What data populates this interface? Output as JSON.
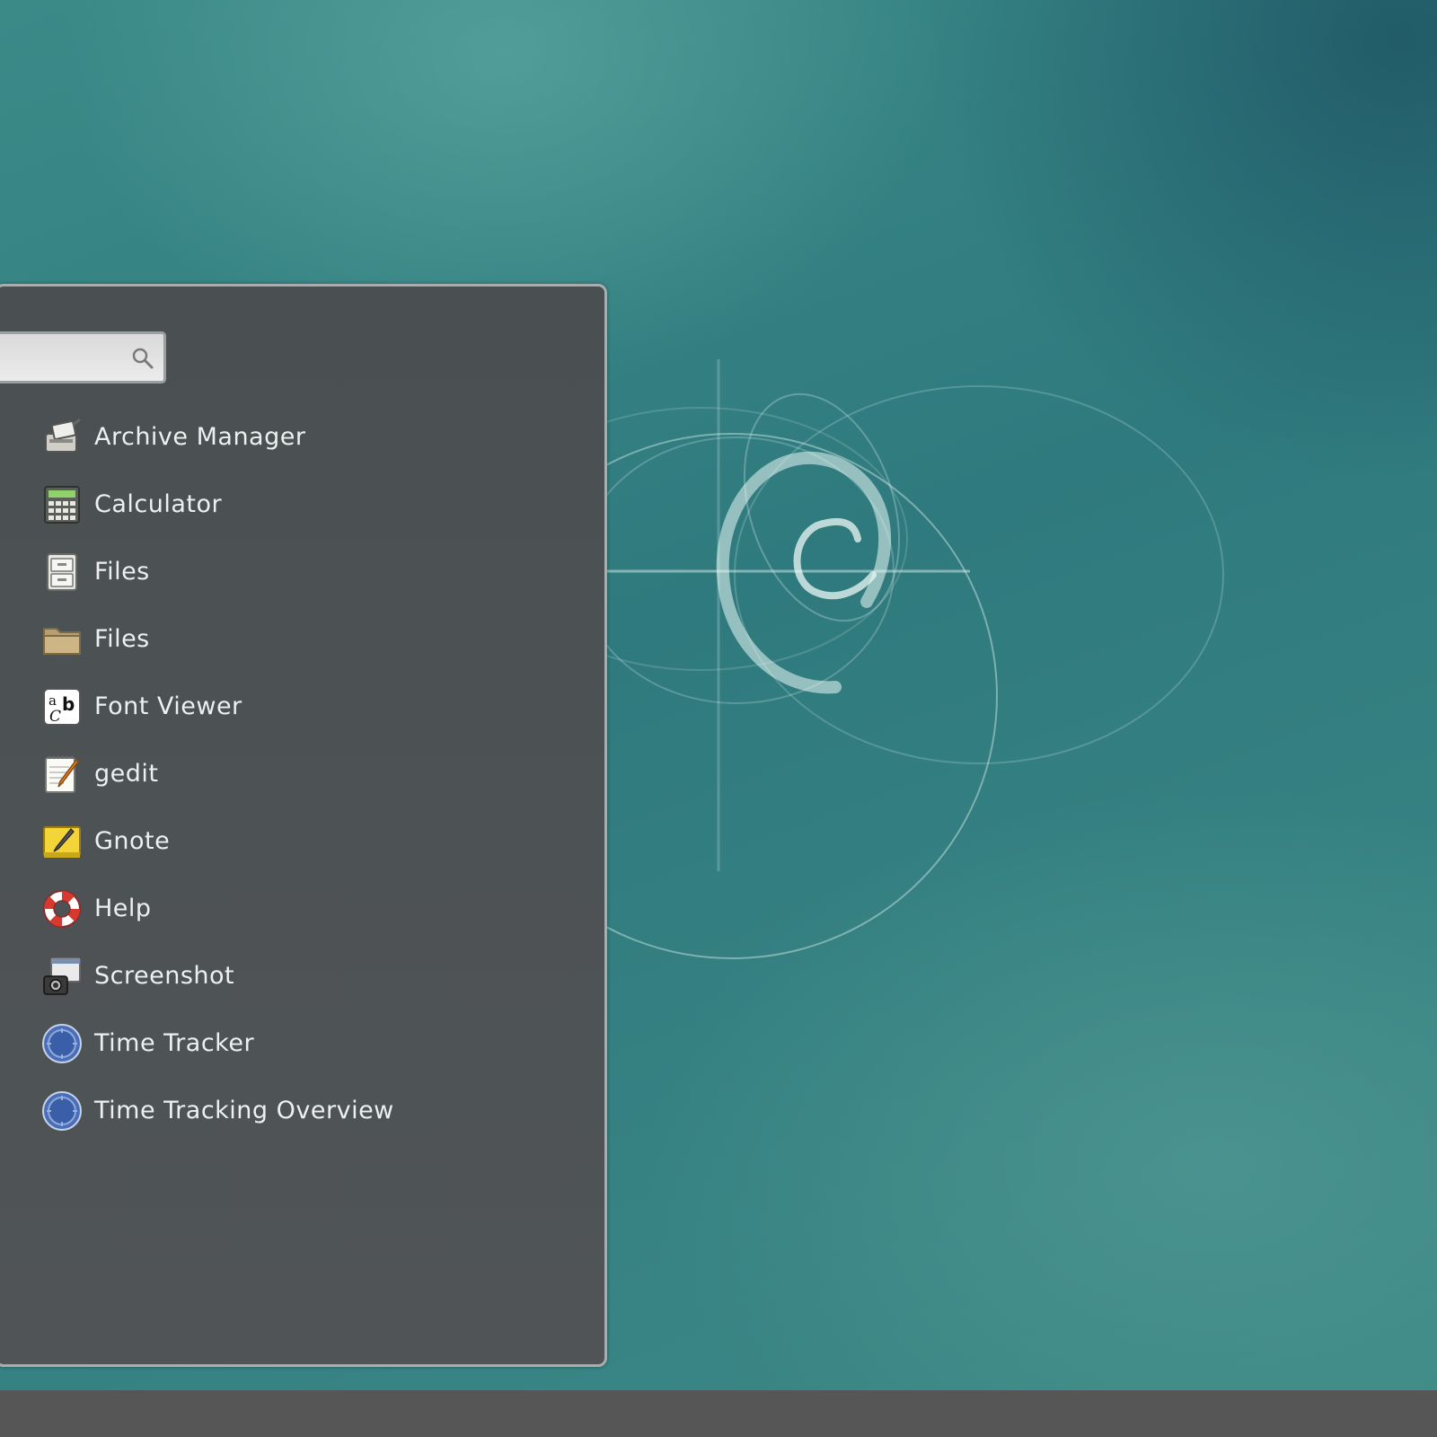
{
  "desktop": {
    "wallpaper": "debian-swirl-teal",
    "colors": {
      "base": "#3b8a88",
      "dark": "#1f5b66",
      "light": "#5aa5a0"
    }
  },
  "menu": {
    "search": {
      "value": "",
      "placeholder": "",
      "icon": "search-icon"
    },
    "apps": [
      {
        "label": "Archive Manager",
        "icon": "archive-manager-icon"
      },
      {
        "label": "Calculator",
        "icon": "calculator-icon"
      },
      {
        "label": "Files",
        "icon": "file-cabinet-icon"
      },
      {
        "label": "Files",
        "icon": "folder-icon"
      },
      {
        "label": "Font Viewer",
        "icon": "font-viewer-icon"
      },
      {
        "label": "gedit",
        "icon": "text-editor-icon"
      },
      {
        "label": "Gnote",
        "icon": "notes-icon"
      },
      {
        "label": "Help",
        "icon": "lifebuoy-icon"
      },
      {
        "label": "Screenshot",
        "icon": "camera-icon"
      },
      {
        "label": "Time Tracker",
        "icon": "clock-icon"
      },
      {
        "label": "Time Tracking Overview",
        "icon": "clock-icon"
      }
    ]
  },
  "taskbar": {
    "color": "#565656"
  }
}
